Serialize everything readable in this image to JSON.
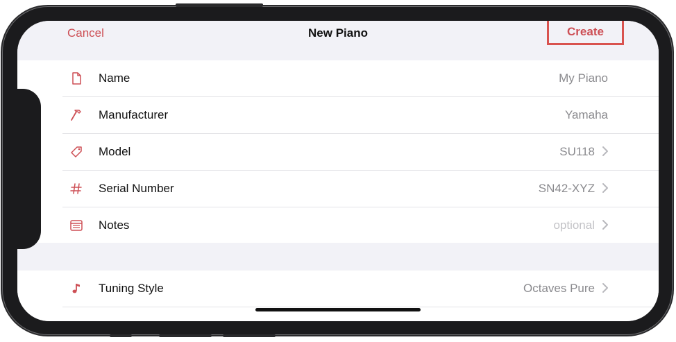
{
  "nav": {
    "cancel_label": "Cancel",
    "title": "New Piano",
    "create_label": "Create"
  },
  "form": {
    "rows": [
      {
        "label": "Name",
        "value": "My Piano",
        "icon": "document-icon",
        "chevron": false
      },
      {
        "label": "Manufacturer",
        "value": "Yamaha",
        "icon": "hammer-icon",
        "chevron": false
      },
      {
        "label": "Model",
        "value": "SU118",
        "icon": "tag-icon",
        "chevron": true
      },
      {
        "label": "Serial Number",
        "value": "SN42-XYZ",
        "icon": "number-sign-icon",
        "chevron": true
      },
      {
        "label": "Notes",
        "value": "optional",
        "icon": "notes-icon",
        "chevron": true
      }
    ],
    "tuning": {
      "label": "Tuning Style",
      "value": "Octaves Pure",
      "icon": "music-note-icon",
      "chevron": true
    }
  },
  "colors": {
    "accent": "#cd4f55",
    "highlight": "#d9534f",
    "background": "#f2f2f7"
  }
}
